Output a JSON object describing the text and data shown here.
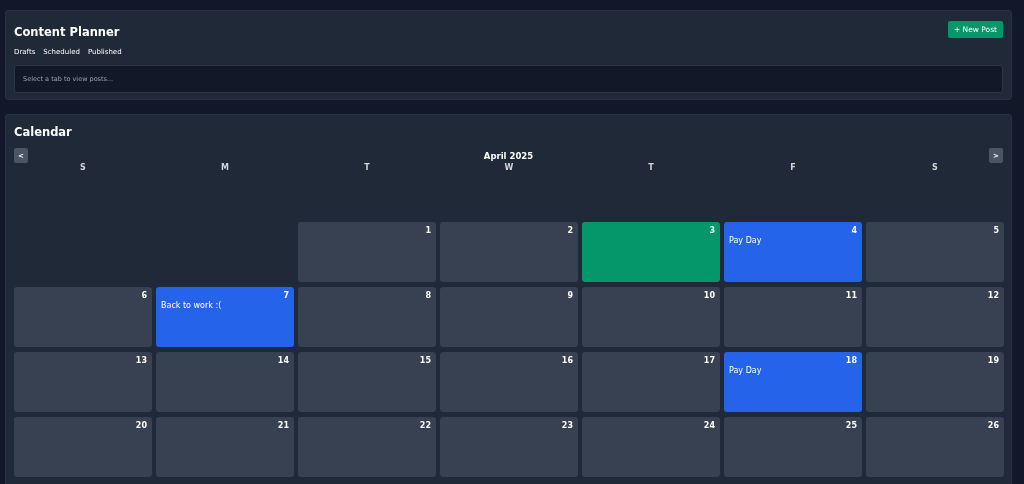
{
  "planner": {
    "title": "Content Planner",
    "new_post_button": "+ New Post",
    "tabs": [
      {
        "label": "Drafts",
        "selected": false
      },
      {
        "label": "Scheduled",
        "selected": false
      },
      {
        "label": "Published",
        "selected": false
      }
    ],
    "posts_message": "Select a tab to view posts..."
  },
  "calendar": {
    "title": "Calendar",
    "prev_button": "<",
    "next_button": ">",
    "month": "April 2025",
    "weekdays": [
      "S",
      "M",
      "T",
      "W",
      "T",
      "F",
      "S"
    ],
    "weeks": [
      [
        {
          "kind": "empty"
        },
        {
          "kind": "empty"
        },
        {
          "kind": "day",
          "day": "1",
          "color": "#374151"
        },
        {
          "kind": "day",
          "day": "2",
          "color": "#374151"
        },
        {
          "kind": "day",
          "day": "3",
          "color": "#059669"
        },
        {
          "kind": "day",
          "day": "4",
          "color": "#2563eb",
          "event": "Pay Day"
        },
        {
          "kind": "day",
          "day": "5",
          "color": "#374151"
        }
      ],
      [
        {
          "kind": "day",
          "day": "6",
          "color": "#374151"
        },
        {
          "kind": "day",
          "day": "7",
          "color": "#2563eb",
          "event": "Back to work :("
        },
        {
          "kind": "day",
          "day": "8",
          "color": "#374151"
        },
        {
          "kind": "day",
          "day": "9",
          "color": "#374151"
        },
        {
          "kind": "day",
          "day": "10",
          "color": "#374151"
        },
        {
          "kind": "day",
          "day": "11",
          "color": "#374151"
        },
        {
          "kind": "day",
          "day": "12",
          "color": "#374151"
        }
      ],
      [
        {
          "kind": "day",
          "day": "13",
          "color": "#374151"
        },
        {
          "kind": "day",
          "day": "14",
          "color": "#374151"
        },
        {
          "kind": "day",
          "day": "15",
          "color": "#374151"
        },
        {
          "kind": "day",
          "day": "16",
          "color": "#374151"
        },
        {
          "kind": "day",
          "day": "17",
          "color": "#374151"
        },
        {
          "kind": "day",
          "day": "18",
          "color": "#2563eb",
          "event": "Pay Day"
        },
        {
          "kind": "day",
          "day": "19",
          "color": "#374151"
        }
      ],
      [
        {
          "kind": "day",
          "day": "20",
          "color": "#374151"
        },
        {
          "kind": "day",
          "day": "21",
          "color": "#374151"
        },
        {
          "kind": "day",
          "day": "22",
          "color": "#374151"
        },
        {
          "kind": "day",
          "day": "23",
          "color": "#374151"
        },
        {
          "kind": "day",
          "day": "24",
          "color": "#374151"
        },
        {
          "kind": "day",
          "day": "25",
          "color": "#374151"
        },
        {
          "kind": "day",
          "day": "26",
          "color": "#374151"
        }
      ]
    ]
  }
}
